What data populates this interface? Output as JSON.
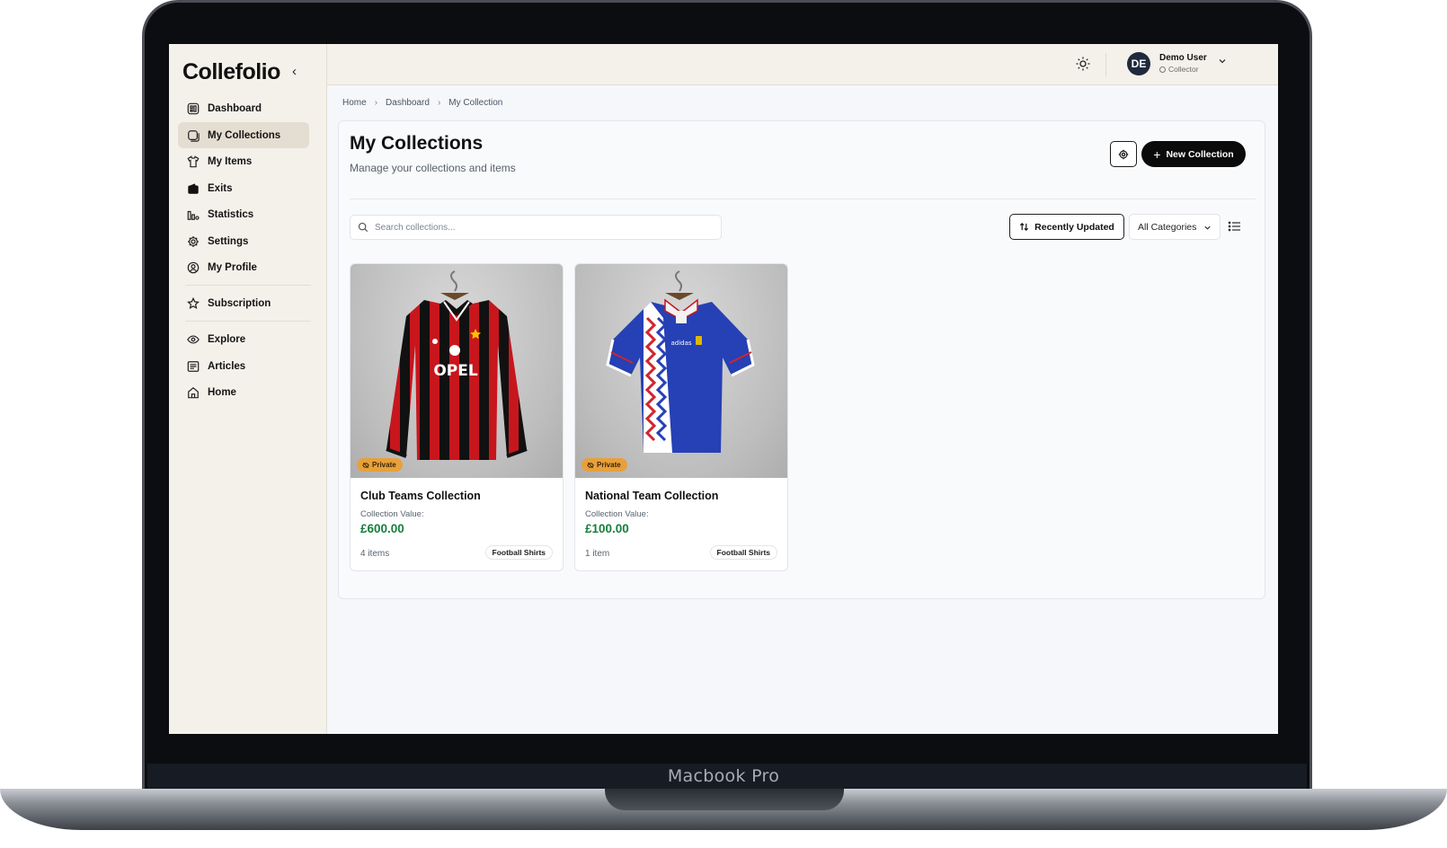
{
  "device": {
    "label": "Macbook Pro"
  },
  "app": {
    "logo": "Collefolio",
    "collapse_glyph": "‹"
  },
  "sidebar": {
    "items": [
      {
        "label": "Dashboard",
        "icon": "dashboard-icon",
        "active": false
      },
      {
        "label": "My Collections",
        "icon": "collections-icon",
        "active": true
      },
      {
        "label": "My Items",
        "icon": "shirt-icon",
        "active": false
      },
      {
        "label": "Exits",
        "icon": "wallet-icon",
        "active": false
      },
      {
        "label": "Statistics",
        "icon": "bar-chart-icon",
        "active": false
      },
      {
        "label": "Settings",
        "icon": "gear-icon",
        "active": false
      },
      {
        "label": "My Profile",
        "icon": "user-circle-icon",
        "active": false
      },
      {
        "label": "Subscription",
        "icon": "star-icon",
        "active": false
      },
      {
        "label": "Explore",
        "icon": "eye-icon",
        "active": false
      },
      {
        "label": "Articles",
        "icon": "newspaper-icon",
        "active": false
      },
      {
        "label": "Home",
        "icon": "home-icon",
        "active": false
      }
    ]
  },
  "topbar": {
    "user": {
      "initials": "DE",
      "name": "Demo User",
      "role": "Collector"
    }
  },
  "breadcrumb": [
    "Home",
    "Dashboard",
    "My Collection"
  ],
  "page": {
    "title": "My Collections",
    "subtitle": "Manage your collections and items",
    "new_button": "New Collection"
  },
  "filters": {
    "search_placeholder": "Search collections...",
    "sort_label": "Recently Updated",
    "category_label": "All Categories"
  },
  "collections": [
    {
      "name": "Club Teams Collection",
      "badge": "Private",
      "value_label": "Collection Value:",
      "value": "£600.00",
      "count": "4 items",
      "tag": "Football Shirts",
      "sponsor": "OPEL"
    },
    {
      "name": "National Team Collection",
      "badge": "Private",
      "value_label": "Collection Value:",
      "value": "£100.00",
      "count": "1 item",
      "tag": "Football Shirts",
      "sponsor": "adidas"
    }
  ],
  "colors": {
    "sidebar_bg": "#f4f1ea",
    "active_item_bg": "#e4ddd1",
    "primary_button": "#0b0b0b",
    "value_green": "#16803c",
    "badge_orange": "#e8a03a"
  }
}
